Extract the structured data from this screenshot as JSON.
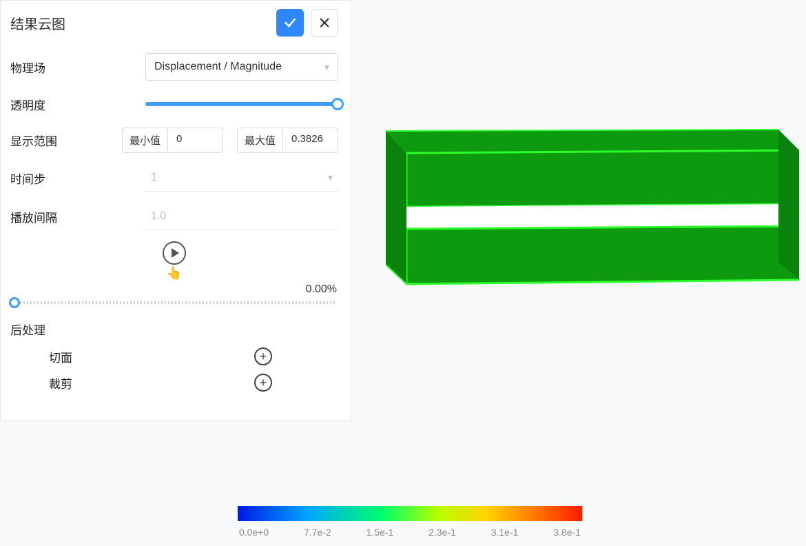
{
  "panel": {
    "title": "结果云图",
    "fields": {
      "physics": {
        "label": "物理场",
        "value": "Displacement / Magnitude"
      },
      "opacity": {
        "label": "透明度"
      },
      "range": {
        "label": "显示范围",
        "min_label": "最小值",
        "min_value": "0",
        "max_label": "最大值",
        "max_value": "0.3826"
      },
      "timestep": {
        "label": "时间步",
        "value": "1"
      },
      "interval": {
        "label": "播放间隔",
        "value": "1.0"
      }
    },
    "progress": "0.00%",
    "post": {
      "title": "后处理",
      "section_plane": "切面",
      "clip": "裁剪"
    }
  },
  "legend": {
    "ticks": [
      "0.0e+0",
      "7.7e-2",
      "1.5e-1",
      "2.3e-1",
      "3.1e-1",
      "3.8e-1"
    ]
  },
  "icons": {
    "plus": "+"
  }
}
